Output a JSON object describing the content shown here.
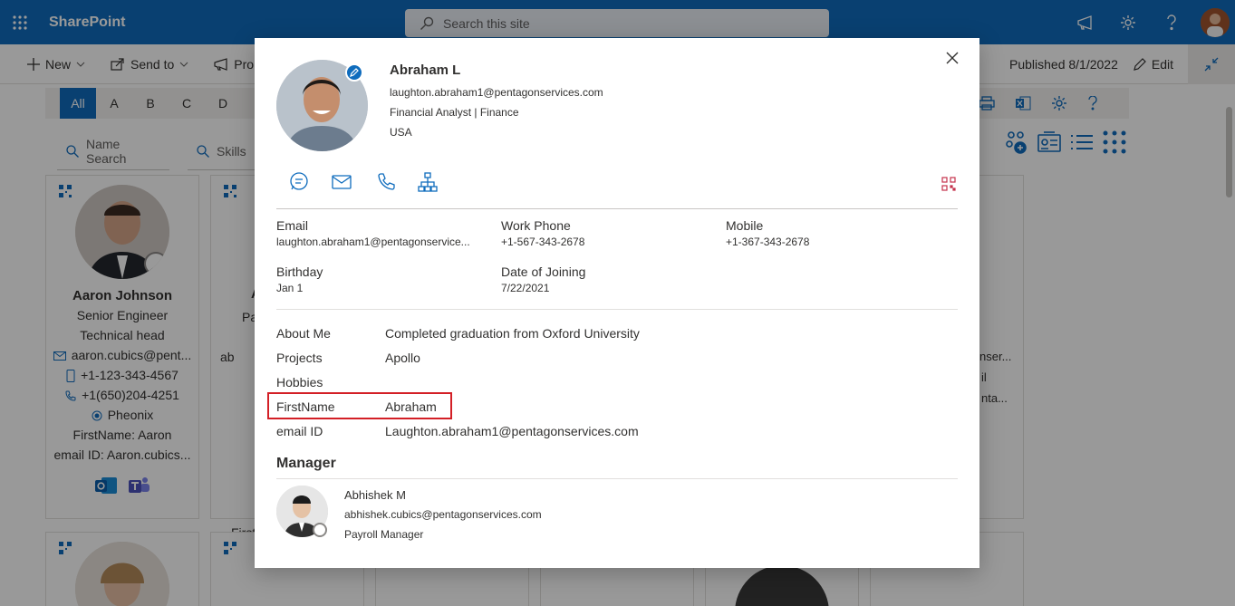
{
  "suite": {
    "app_name": "SharePoint",
    "search_placeholder": "Search this site"
  },
  "commandbar": {
    "new_label": "New",
    "send_label": "Send to",
    "promote_label": "Prom",
    "published": "Published 8/1/2022",
    "edit_label": "Edit"
  },
  "alphabet": [
    "All",
    "A",
    "B",
    "C",
    "D"
  ],
  "filters": {
    "name_search": "Name Search",
    "skills": "Skills"
  },
  "cards": [
    {
      "name": "Aaron Johnson",
      "title": "Senior Engineer",
      "dept": "Technical head",
      "email": "aaron.cubics@pent...",
      "phone": "+1-123-343-4567",
      "work": "+1(650)204-4251",
      "location": "Pheonix",
      "firstname": "FirstName: Aaron",
      "emailid": "email ID: Aaron.cubics..."
    },
    {
      "name": "A",
      "title": "Pa",
      "email": "ab",
      "firstname": "First",
      "emailid": "email"
    }
  ],
  "partial_right": {
    "l1": "nser...",
    "l2": "il",
    "l3": "nta..."
  },
  "profile": {
    "name": "Abraham L",
    "email": "laughton.abraham1@pentagonservices.com",
    "job": "Financial Analyst | Finance",
    "country": "USA",
    "fields": {
      "email_label": "Email",
      "email_value": "laughton.abraham1@pentagonservice...",
      "workphone_label": "Work Phone",
      "workphone_value": "+1-567-343-2678",
      "mobile_label": "Mobile",
      "mobile_value": "+1-367-343-2678",
      "birthday_label": "Birthday",
      "birthday_value": "Jan 1",
      "doj_label": "Date of Joining",
      "doj_value": "7/22/2021"
    },
    "about": [
      {
        "key": "About Me",
        "value": "Completed graduation from Oxford University"
      },
      {
        "key": "Projects",
        "value": "Apollo"
      },
      {
        "key": "Hobbies",
        "value": ""
      },
      {
        "key": "FirstName",
        "value": "Abraham"
      },
      {
        "key": "email ID",
        "value": "Laughton.abraham1@pentagonservices.com"
      }
    ],
    "manager_heading": "Manager",
    "manager": {
      "name": "Abhishek M",
      "email": "abhishek.cubics@pentagonservices.com",
      "title": "Payroll Manager"
    }
  },
  "colors": {
    "brand": "#0f6cbd",
    "highlight": "#d31f26"
  }
}
